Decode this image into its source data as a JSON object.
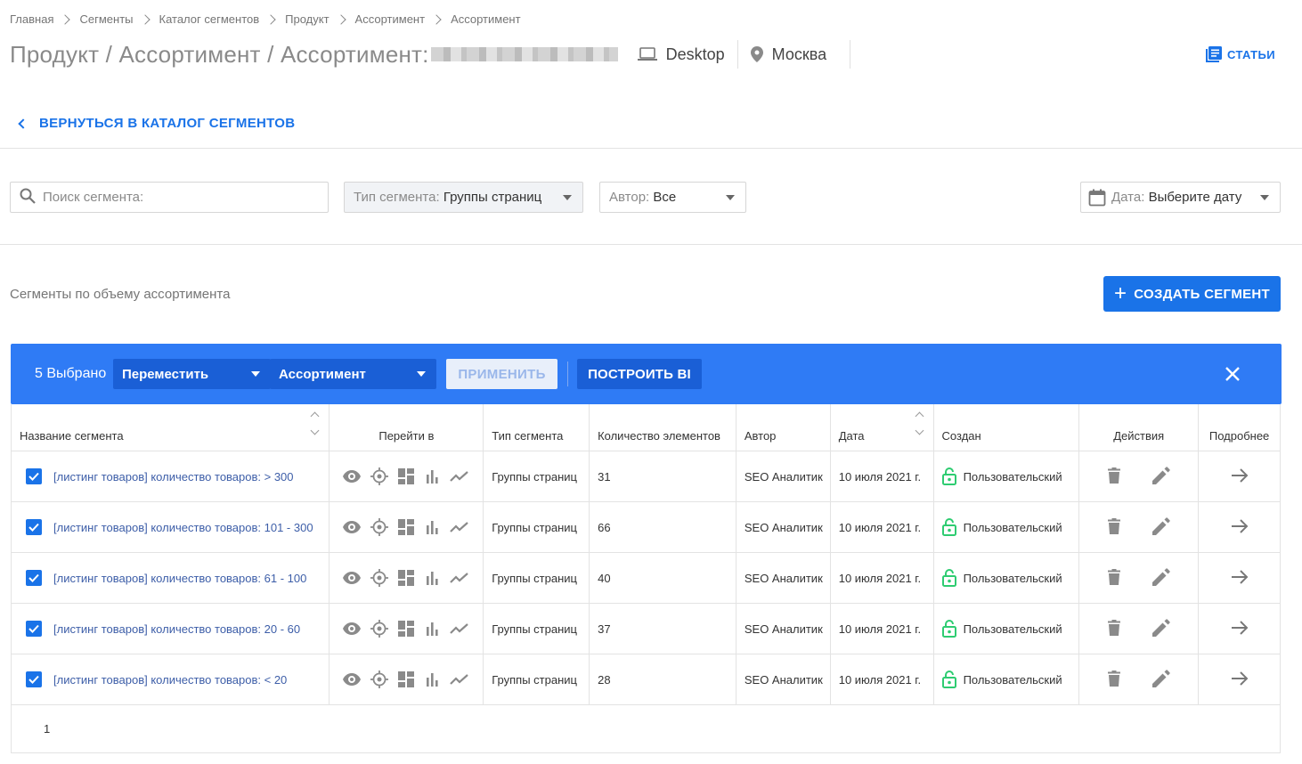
{
  "breadcrumb": [
    "Главная",
    "Сегменты",
    "Каталог сегментов",
    "Продукт",
    "Ассортимент",
    "Ассортимент"
  ],
  "header": {
    "title": "Продукт / Ассортимент / Ассортимент:",
    "device": "Desktop",
    "region": "Москва",
    "articles": "СТАТЬИ"
  },
  "back_link": "ВЕРНУТЬСЯ В КАТАЛОГ СЕГМЕНТОВ",
  "filters": {
    "search_placeholder": "Поиск сегмента:",
    "type_label": "Тип сегмента:",
    "type_value": "Группы страниц",
    "author_label": "Автор:",
    "author_value": "Все",
    "date_label": "Дата:",
    "date_value": "Выберите дату"
  },
  "section_title": "Сегменты по объему ассортимента",
  "create_button": "СОЗДАТЬ СЕГМЕНТ",
  "action_bar": {
    "selected": "5 Выбрано",
    "action": "Переместить",
    "target": "Ассортимент",
    "apply": "ПРИМЕНИТЬ",
    "build_bi": "ПОСТРОИТЬ BI"
  },
  "table": {
    "columns": [
      "Название сегмента",
      "Перейти в",
      "Тип сегмента",
      "Количество элементов",
      "Автор",
      "Дата",
      "Создан",
      "Действия",
      "Подробнее"
    ],
    "rows": [
      {
        "name": "[листинг товаров] количество товаров: > 300",
        "type": "Группы страниц",
        "count": "31",
        "author": "SEO Аналитик",
        "date": "10 июля 2021 г.",
        "created": "Пользовательский"
      },
      {
        "name": "[листинг товаров] количество товаров: 101 - 300",
        "type": "Группы страниц",
        "count": "66",
        "author": "SEO Аналитик",
        "date": "10 июля 2021 г.",
        "created": "Пользовательский"
      },
      {
        "name": "[листинг товаров] количество товаров: 61 - 100",
        "type": "Группы страниц",
        "count": "40",
        "author": "SEO Аналитик",
        "date": "10 июля 2021 г.",
        "created": "Пользовательский"
      },
      {
        "name": "[листинг товаров] количество товаров: 20 - 60",
        "type": "Группы страниц",
        "count": "37",
        "author": "SEO Аналитик",
        "date": "10 июля 2021 г.",
        "created": "Пользовательский"
      },
      {
        "name": "[листинг товаров] количество товаров: < 20",
        "type": "Группы страниц",
        "count": "28",
        "author": "SEO Аналитик",
        "date": "10 июля 2021 г.",
        "created": "Пользовательский"
      }
    ]
  },
  "pagination": {
    "current_page": "1"
  },
  "icons": {
    "row_nav": [
      "eye-icon",
      "target-icon",
      "dashboard-icon",
      "bar-chart-icon",
      "trend-icon"
    ],
    "row_actions": [
      "trash-icon",
      "pencil-icon"
    ],
    "row_more": "arrow-right-icon"
  },
  "colors": {
    "accent": "#1a73e8",
    "action_bar": "#2f7bf5",
    "lock_green": "#2ecc71"
  }
}
